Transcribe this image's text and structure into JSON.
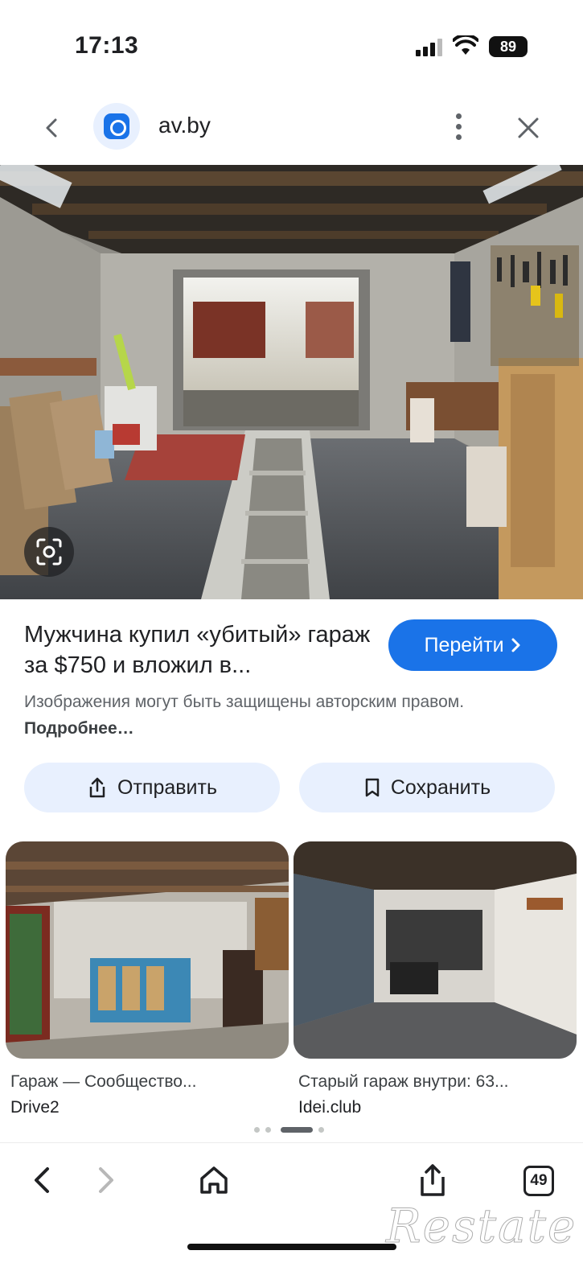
{
  "status": {
    "time": "17:13",
    "battery": "89"
  },
  "browser": {
    "domain": "av.by"
  },
  "result": {
    "title": "Мужчина купил «убитый» гараж за $750 и вложил в...",
    "visit_label": "Перейти",
    "copyright_text": "Изображения могут быть защищены авторским правом.",
    "more_link": "Подробнее…"
  },
  "actions": {
    "share_label": "Отправить",
    "save_label": "Сохранить"
  },
  "related": [
    {
      "title": "Гараж — Сообщество...",
      "source": "Drive2"
    },
    {
      "title": "Старый гараж внутри: 63...",
      "source": "Idei.club"
    }
  ],
  "toolbar": {
    "tabs_count": "49"
  },
  "watermark": "Restate",
  "colors": {
    "accent": "#1a73e8",
    "chip_bg": "#e8f0fe",
    "secondary_text": "#5f6368"
  },
  "icons": [
    "back-icon",
    "favicon-icon",
    "more-vert-icon",
    "close-icon",
    "lens-icon",
    "share-icon",
    "bookmark-icon",
    "chevron-right-icon",
    "forward-icon",
    "home-icon",
    "tabs-icon"
  ]
}
